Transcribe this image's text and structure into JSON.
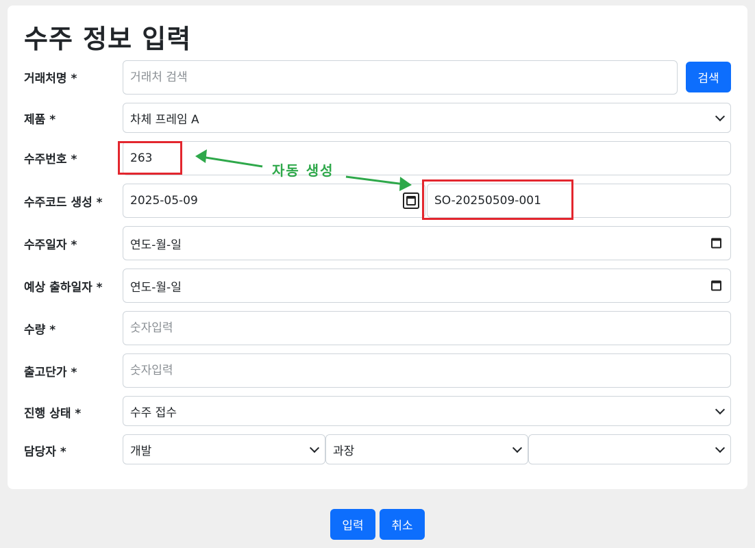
{
  "form": {
    "title": "수주 정보 입력",
    "fields": {
      "client": {
        "label": "거래처명 *",
        "placeholder": "거래처 검색",
        "button": "검색"
      },
      "product": {
        "label": "제품 *",
        "value": "차체 프레임 A"
      },
      "order_no": {
        "label": "수주번호 *",
        "value": "263"
      },
      "order_code": {
        "label": "수주코드 생성 *",
        "date": "2025-05-09",
        "code": "SO-20250509-001"
      },
      "order_date": {
        "label": "수주일자 *",
        "value": "연도-월-일"
      },
      "ship_date": {
        "label": "예상 출하일자 *",
        "value": "연도-월-일"
      },
      "quantity": {
        "label": "수량 *",
        "placeholder": "숫자입력"
      },
      "unit_price": {
        "label": "출고단가 *",
        "placeholder": "숫자입력"
      },
      "status": {
        "label": "진행 상태 *",
        "value": "수주 접수"
      },
      "manager": {
        "label": "담당자 *",
        "department": "개발",
        "position": "과장",
        "person": ""
      }
    },
    "annotation": {
      "text": "자동 생성",
      "color": "#2ea84a",
      "box_color": "#e3262e"
    }
  },
  "actions": {
    "submit": "입력",
    "cancel": "취소"
  },
  "colors": {
    "primary": "#0d6efd",
    "background": "#efefef",
    "card": "#ffffff"
  }
}
